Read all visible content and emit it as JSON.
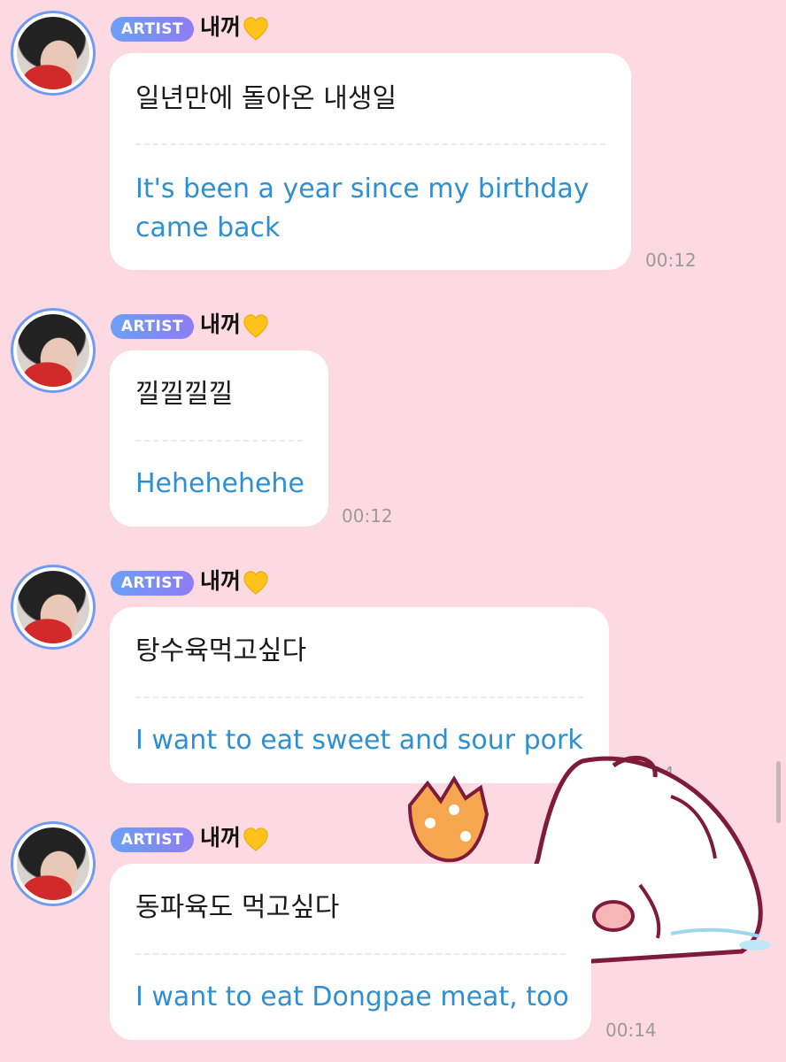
{
  "messages": [
    {
      "badge": "ARTIST",
      "author": "내꺼",
      "korean": "일년만에 돌아온 내생일",
      "english": [
        "It's been a year since my birthday",
        "came back"
      ],
      "time": "00:12"
    },
    {
      "badge": "ARTIST",
      "author": "내꺼",
      "korean": "낄낄낄낄",
      "english": [
        "Hehehehehe"
      ],
      "time": "00:12"
    },
    {
      "badge": "ARTIST",
      "author": "내꺼",
      "korean": "탕수육먹고싶다",
      "english": [
        "I want to eat sweet and sour pork"
      ],
      "time": "00:14"
    },
    {
      "badge": "ARTIST",
      "author": "내꺼",
      "korean": "동파육도 먹고싶다",
      "english": [
        "I want to eat Dongpae meat, too"
      ],
      "time": "00:14"
    }
  ],
  "colors": {
    "background": "#fdd9e1",
    "translation_text": "#2f8fd0",
    "badge_start": "#6aa0f5",
    "badge_end": "#8f7cf3",
    "avatar_ring": "#6f9cf2"
  },
  "icons": {
    "heart": "yellow-heart-icon",
    "sticker": "sleeping-bunny-with-crown-sticker"
  }
}
